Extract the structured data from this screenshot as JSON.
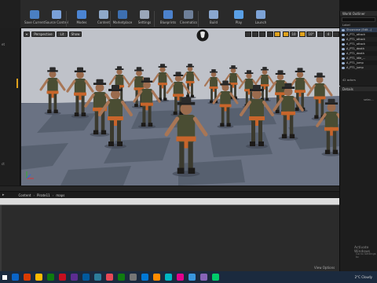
{
  "toolbar": {
    "buttons": [
      {
        "label": "Save Current",
        "icon": "save-icon"
      },
      {
        "label": "Source Control",
        "icon": "source-control-icon"
      },
      {
        "label": "Modes",
        "icon": "modes-icon"
      },
      {
        "label": "Content",
        "icon": "content-icon"
      },
      {
        "label": "Marketplace",
        "icon": "marketplace-icon"
      },
      {
        "label": "Settings",
        "icon": "gear-icon"
      },
      {
        "label": "Blueprints",
        "icon": "blueprint-icon"
      },
      {
        "label": "Cinematics",
        "icon": "cinematics-icon"
      },
      {
        "label": "Build",
        "icon": "build-icon"
      },
      {
        "label": "Play",
        "icon": "play-icon"
      },
      {
        "label": "Launch",
        "icon": "launch-icon"
      }
    ]
  },
  "viewport": {
    "perspective_label": "Perspective",
    "lit_label": "Lit",
    "show_label": "Show",
    "snap_value": "10",
    "angle_value": "10°",
    "scale_value": "0.25",
    "camera_speed": "4"
  },
  "left_panel": {
    "items": [
      "et",
      "ct"
    ]
  },
  "world_outliner": {
    "title": "World Outliner",
    "column_label": "Label",
    "rows": [
      "Showcase (Edit...)",
      "A_PT1_attack",
      "A_PT1_attack",
      "A_PT1_attack",
      "A_PT1_death",
      "A_PT1_death",
      "A_PT1_idle_...",
      "A_PT1_jump",
      "A_PT1_jump"
    ],
    "count": "42 actors"
  },
  "details": {
    "title": "Details",
    "hint": "selec..."
  },
  "content_browser": {
    "breadcrumb": [
      "Content",
      "Pirate11",
      "maps"
    ],
    "view_options": "View Options"
  },
  "activation": {
    "line1": "Activate Windows",
    "line2": "Go to Settings to"
  },
  "taskbar": {
    "weather": "2°C Cloudy",
    "colors": [
      "#0a64c8",
      "#d83b01",
      "#ffb900",
      "#0f7b0f",
      "#c50f1f",
      "#5c2d91",
      "#005a9e",
      "#2d7d9a",
      "#e74856",
      "#107c10",
      "#767676",
      "#0078d7",
      "#ff8c00",
      "#00b7c3",
      "#e3008c",
      "#3a96dd",
      "#8764b8",
      "#00cc6a"
    ]
  }
}
